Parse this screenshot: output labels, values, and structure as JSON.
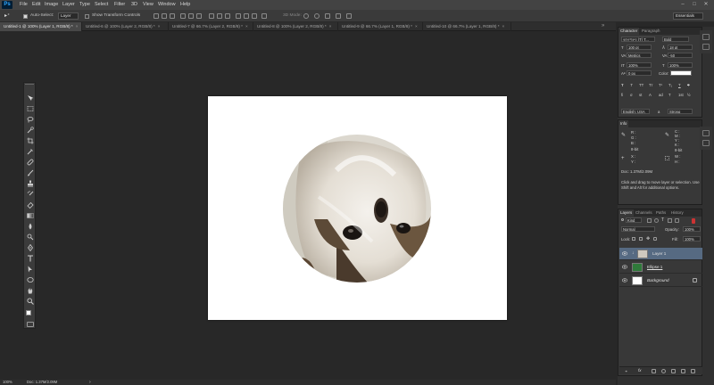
{
  "app": {
    "logo": "Ps"
  },
  "menu": [
    "File",
    "Edit",
    "Image",
    "Layer",
    "Type",
    "Select",
    "Filter",
    "3D",
    "View",
    "Window",
    "Help"
  ],
  "window_controls": {
    "minimize": "–",
    "maximize": "□",
    "close": "✕"
  },
  "options_bar": {
    "auto_select_label": "Auto-Select:",
    "auto_select_value": "Layer",
    "show_transform_label": "Show Transform Controls",
    "mode_3d_label": "3D Mode:",
    "workspace": "Essentials"
  },
  "tabs": [
    {
      "label": "Untitled-1 @ 100% (Layer 1, RGB/8) *",
      "active": true
    },
    {
      "label": "Untitled-6 @ 100% (Layer 2, RGB/8) *",
      "active": false
    },
    {
      "label": "Untitled-7 @ 66.7% (Layer 2, RGB/8) *",
      "active": false
    },
    {
      "label": "Untitled-8 @ 100% (Layer 2, RGB/8) *",
      "active": false
    },
    {
      "label": "Untitled-9 @ 66.7% (Layer 1, RGB/8) *",
      "active": false
    },
    {
      "label": "Untitled-10 @ 66.7% (Layer 1, RGB/8) *",
      "active": false
    }
  ],
  "status": {
    "zoom": "100%",
    "doc": "Doc: 1.37M/2.09M"
  },
  "character_panel": {
    "tabs": [
      "Character",
      "Paragraph"
    ],
    "font_family": "কালপুরুষ (T) T...",
    "font_style": "Bold",
    "size": "100 pt",
    "leading": "18 pt",
    "kerning": "Metrics",
    "tracking": "-50",
    "vertical_scale": "100%",
    "horizontal_scale": "100%",
    "baseline": "0 px",
    "color_label": "Color:",
    "language": "English: USA",
    "aa_label": "a",
    "aa": "Strong",
    "type_buttons": [
      "T",
      "T",
      "TT",
      "Tт",
      "T¹",
      "T₁",
      "T",
      "T"
    ],
    "extra_buttons": [
      "fi",
      "σ",
      "st",
      "A",
      "ad",
      "T",
      "1st",
      "½"
    ]
  },
  "info_panel": {
    "tab": "Info",
    "r": "R :",
    "g": "G :",
    "b": "B :",
    "c": "C :",
    "m": "M :",
    "y": "Y :",
    "k": "K :",
    "bit_left": "8-bit",
    "bit_right": "8-bit",
    "x": "X :",
    "yc": "Y :",
    "w": "W :",
    "h": "H :",
    "doc": "Doc: 1.37M/2.09M",
    "hint": "Click and drag to move layer or selection.  Use Shift and Alt for additional options."
  },
  "layers_panel": {
    "tabs": [
      "Layers",
      "Channels",
      "Paths",
      "History"
    ],
    "filter_kind": "Kind",
    "blend_mode": "Normal",
    "opacity_label": "Opacity:",
    "opacity": "100%",
    "lock_label": "Lock:",
    "fill_label": "Fill:",
    "fill": "100%",
    "layers": [
      {
        "name": "Layer 1",
        "selected": true
      },
      {
        "name": "Ellipse 1",
        "selected": false
      },
      {
        "name": "Background",
        "selected": false
      }
    ],
    "bottom_icons": [
      "fx"
    ]
  },
  "colors": {
    "layer_selected": "#566a82",
    "foreground": "#ffffff",
    "background": "#000000",
    "ellipse_thumb": "#2f7a3a"
  },
  "icons": [
    "move-icon",
    "marquee-icon",
    "lasso-icon",
    "quick-select-icon",
    "crop-icon",
    "eyedropper-icon",
    "healing-icon",
    "brush-icon",
    "clone-stamp-icon",
    "history-brush-icon",
    "eraser-icon",
    "gradient-icon",
    "blur-icon",
    "dodge-icon",
    "pen-icon",
    "type-icon",
    "path-select-icon",
    "shape-icon",
    "hand-icon",
    "zoom-icon"
  ]
}
